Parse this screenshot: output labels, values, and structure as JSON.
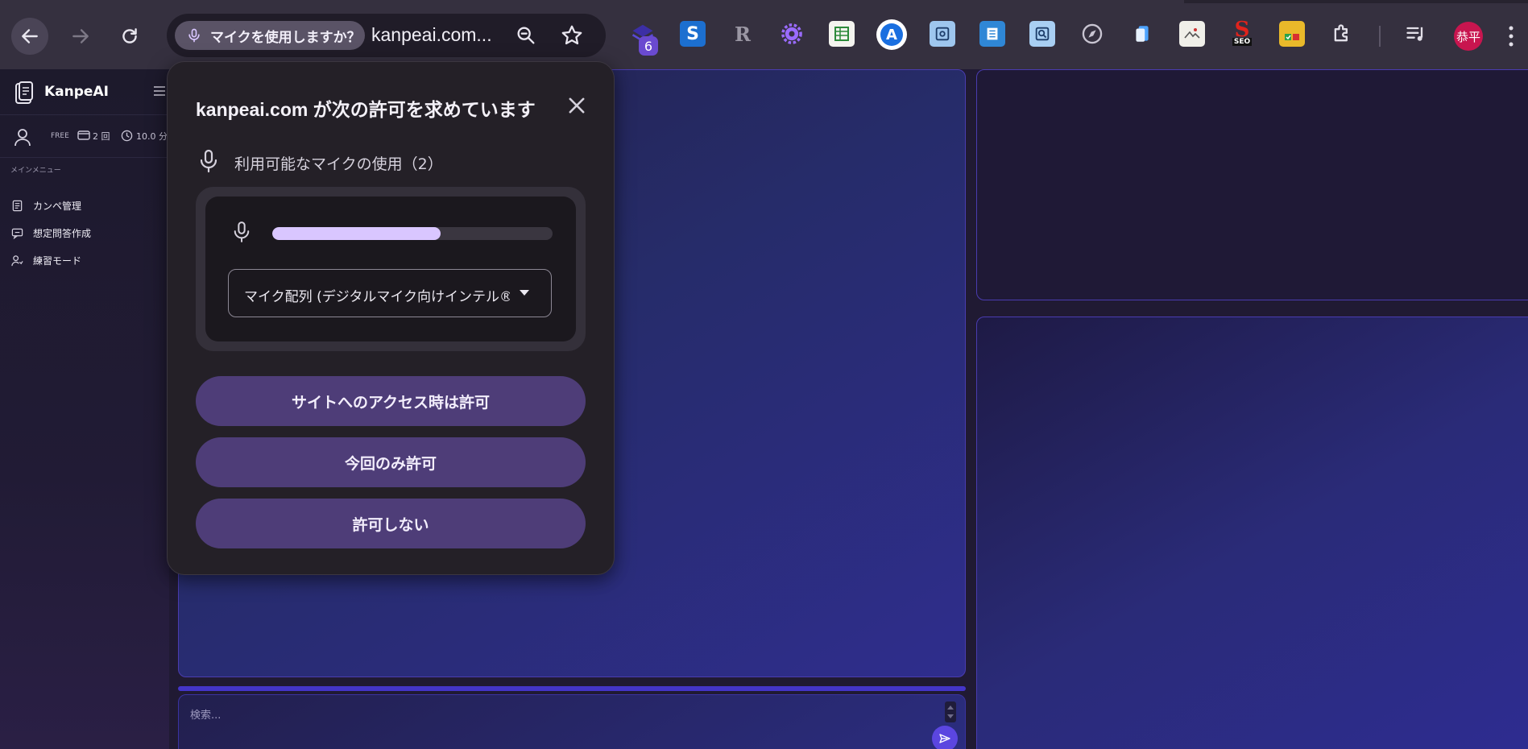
{
  "browser": {
    "mic_chip_label": "マイクを使用しますか？",
    "url": "kanpeai.com...",
    "extension_badge": "6",
    "profile_name": "恭平",
    "extensions": [
      "layers-ext-icon",
      "s-ext-icon",
      "r-ext-icon",
      "gear-ext-icon",
      "sheet-ext-icon",
      "a-ext-icon",
      "qr-ext-icon",
      "doc-ext-icon",
      "search-ext-icon",
      "compass-ext-icon",
      "clipboard-ext-icon",
      "image-ext-icon",
      "seo-ext-icon",
      "check-ext-icon",
      "puzzle-icon",
      "media-icon"
    ],
    "seo_label": "SEO"
  },
  "sidebar": {
    "title": "KanpeAI",
    "plan": "FREE",
    "count": "2 回",
    "minutes": "10.0 分",
    "section": "メインメニュー",
    "items": [
      {
        "label": "カンペ管理",
        "icon": "document-icon"
      },
      {
        "label": "想定問答作成",
        "icon": "chat-icon"
      },
      {
        "label": "練習モード",
        "icon": "user-practice-icon"
      }
    ]
  },
  "main": {
    "search_placeholder": "検索..."
  },
  "dialog": {
    "title": "kanpeai.com が次の許可を求めています",
    "permission": "利用可能なマイクの使用（2）",
    "mic_level": 0.6,
    "selected_device": "マイク配列 (デジタルマイク向けインテル®...",
    "buttons": {
      "allow_always": "サイトへのアクセス時は許可",
      "allow_once": "今回のみ許可",
      "deny": "許可しない"
    }
  },
  "colors": {
    "accent": "#d9c6ff",
    "button_bg": "#4e3d78",
    "avatar": "#c8154f"
  }
}
